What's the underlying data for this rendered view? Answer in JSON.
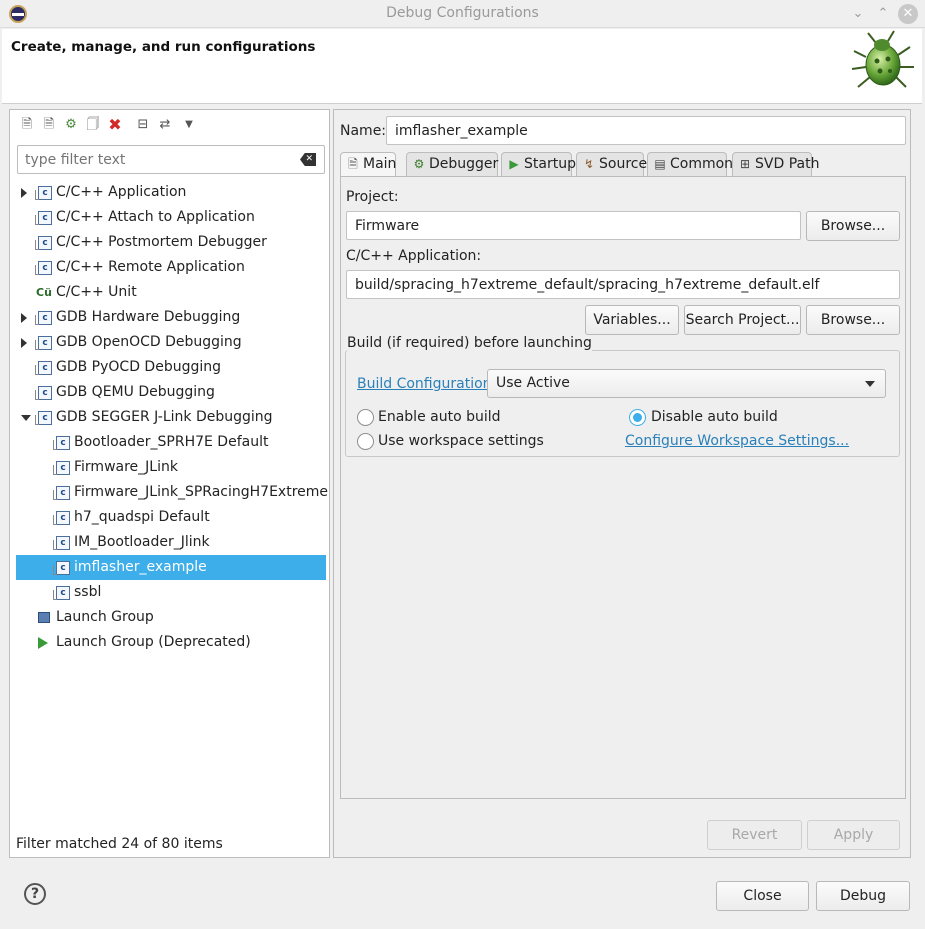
{
  "window": {
    "title": "Debug Configurations"
  },
  "header": {
    "title": "Create, manage, and run configurations"
  },
  "left": {
    "filter_placeholder": "type filter text",
    "items": [
      {
        "label": "C/C++ Application",
        "expander": "collapsed",
        "indent": 0,
        "icon": "c-config-icon"
      },
      {
        "label": "C/C++ Attach to Application",
        "expander": "none",
        "indent": 0,
        "icon": "c-config-icon"
      },
      {
        "label": "C/C++ Postmortem Debugger",
        "expander": "none",
        "indent": 0,
        "icon": "c-config-icon"
      },
      {
        "label": "C/C++ Remote Application",
        "expander": "none",
        "indent": 0,
        "icon": "c-config-icon"
      },
      {
        "label": "C/C++ Unit",
        "expander": "none",
        "indent": 0,
        "icon": "cunit-icon"
      },
      {
        "label": "GDB Hardware Debugging",
        "expander": "collapsed",
        "indent": 0,
        "icon": "c-config-icon"
      },
      {
        "label": "GDB OpenOCD Debugging",
        "expander": "collapsed",
        "indent": 0,
        "icon": "c-config-icon"
      },
      {
        "label": "GDB PyOCD Debugging",
        "expander": "none",
        "indent": 0,
        "icon": "c-config-icon"
      },
      {
        "label": "GDB QEMU Debugging",
        "expander": "none",
        "indent": 0,
        "icon": "c-config-icon"
      },
      {
        "label": "GDB SEGGER J-Link Debugging",
        "expander": "expanded",
        "indent": 0,
        "icon": "c-config-icon"
      },
      {
        "label": "Bootloader_SPRH7E Default",
        "expander": "none",
        "indent": 1,
        "icon": "c-config-icon"
      },
      {
        "label": "Firmware_JLink",
        "expander": "none",
        "indent": 1,
        "icon": "c-config-icon"
      },
      {
        "label": "Firmware_JLink_SPRacingH7Extreme",
        "expander": "none",
        "indent": 1,
        "icon": "c-config-icon"
      },
      {
        "label": "h7_quadspi Default",
        "expander": "none",
        "indent": 1,
        "icon": "c-config-icon"
      },
      {
        "label": "IM_Bootloader_Jlink",
        "expander": "none",
        "indent": 1,
        "icon": "c-config-icon"
      },
      {
        "label": "imflasher_example",
        "expander": "none",
        "indent": 1,
        "icon": "c-config-icon",
        "selected": true
      },
      {
        "label": "ssbl",
        "expander": "none",
        "indent": 1,
        "icon": "c-config-icon"
      },
      {
        "label": "Launch Group",
        "expander": "none",
        "indent": 0,
        "icon": "launch-group-icon"
      },
      {
        "label": "Launch Group (Deprecated)",
        "expander": "none",
        "indent": 0,
        "icon": "launch-arrow-icon"
      }
    ],
    "status": "Filter matched 24 of 80 items"
  },
  "right": {
    "name_label": "Name:",
    "name_value": "imflasher_example",
    "tabs": [
      {
        "label": "Main",
        "icon": "document-icon",
        "active": true
      },
      {
        "label": "Debugger",
        "icon": "bug-icon"
      },
      {
        "label": "Startup",
        "icon": "play-icon"
      },
      {
        "label": "Source",
        "icon": "source-icon"
      },
      {
        "label": "Common",
        "icon": "common-icon"
      },
      {
        "label": "SVD Path",
        "icon": "svd-icon"
      }
    ],
    "project_label": "Project:",
    "project_value": "Firmware",
    "browse_label": "Browse...",
    "app_label": "C/C++ Application:",
    "app_value": "build/spracing_h7extreme_default/spracing_h7extreme_default.elf",
    "variables_label": "Variables...",
    "search_project_label": "Search Project...",
    "browse2_label": "Browse...",
    "build_group_title": "Build (if required) before launching",
    "build_config_link": "Build Configuration:",
    "build_config_value": "Use Active",
    "enable_auto_build": "Enable auto build",
    "disable_auto_build": "Disable auto build",
    "use_workspace": "Use workspace settings",
    "configure_workspace_link": "Configure Workspace Settings...",
    "revert_label": "Revert",
    "apply_label": "Apply"
  },
  "footer": {
    "close_label": "Close",
    "debug_label": "Debug",
    "help_symbol": "?"
  }
}
